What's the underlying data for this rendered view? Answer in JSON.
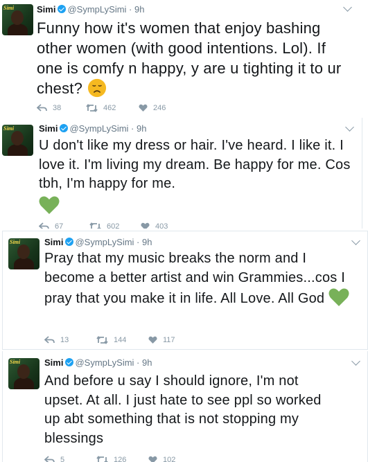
{
  "colors": {
    "verified": "#1da1f2",
    "text": "#14171a",
    "meta": "#657786",
    "icon": "#8899a6",
    "sad_emoji": "#f5b921",
    "heart_emoji": "#78b159"
  },
  "tweets": [
    {
      "name": "Simi",
      "handle": "@SympLySimi",
      "sep": "·",
      "time": "9h",
      "text": "Funny how it's women that enjoy bashing other women (with good intentions. Lol). If one is comfy n happy, y are u tighting it to ur chest?",
      "emoji": "disappointed-face-emoji",
      "reply_count": "38",
      "retweet_count": "462",
      "like_count": "246"
    },
    {
      "name": "Simi",
      "handle": "@SympLySimi",
      "sep": "·",
      "time": "9h",
      "text": "U don't like my dress or hair. I've heard. I like it. I love it. I'm living my dream. Be happy for me. Cos tbh, I'm happy for me.",
      "emoji": "green-heart-emoji",
      "reply_count": "67",
      "retweet_count": "602",
      "like_count": "403"
    },
    {
      "name": "Simi",
      "handle": "@SympLySimi",
      "sep": "·",
      "time": "9h",
      "text": "Pray that my music breaks the norm and I become a better artist and win Grammies...cos I pray that you make it in life. All Love. All God",
      "emoji": "green-heart-emoji",
      "reply_count": "13",
      "retweet_count": "144",
      "like_count": "117"
    },
    {
      "name": "Simi",
      "handle": "@SympLySimi",
      "sep": "·",
      "time": "9h",
      "text": "And before u say I should ignore, I'm not upset. At all. I just hate to see ppl so worked up abt something that is not stopping my blessings",
      "emoji": "",
      "reply_count": "5",
      "retweet_count": "126",
      "like_count": "102"
    }
  ],
  "avatar_label": "Simi"
}
